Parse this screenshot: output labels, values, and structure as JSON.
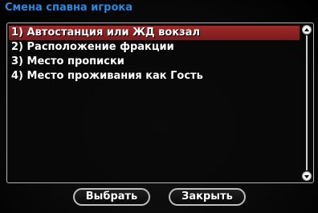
{
  "dialog": {
    "title": "Смена спавна игрока"
  },
  "list": {
    "selected_index": 0,
    "items": [
      {
        "label": "1) Автостанция или ЖД вокзал"
      },
      {
        "label": "2) Расположение фракции"
      },
      {
        "label": "3) Место прописки"
      },
      {
        "label": "4) Место проживания как Гость"
      }
    ]
  },
  "buttons": {
    "select_label": "Выбрать",
    "close_label": "Закрыть"
  },
  "colors": {
    "title": "#2a8bdd",
    "selection": "#8b2020"
  }
}
